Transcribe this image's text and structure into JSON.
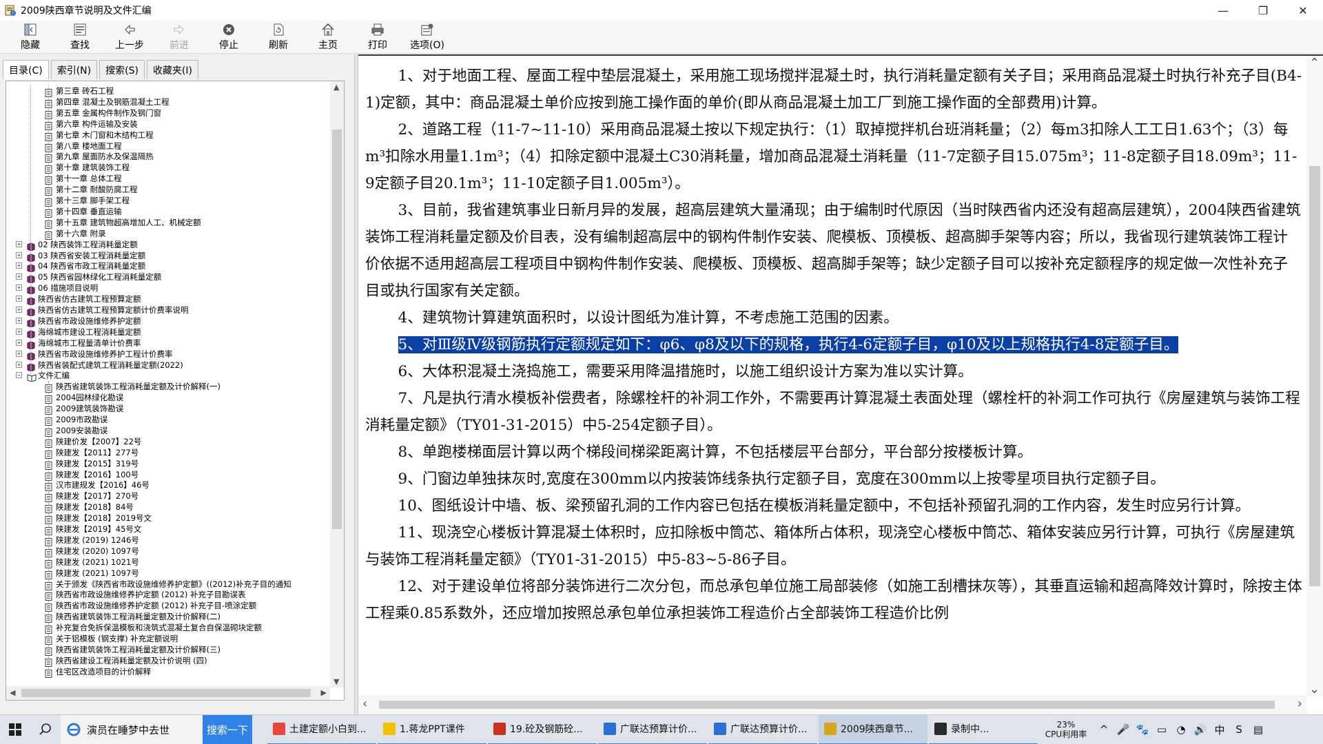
{
  "window": {
    "title": "2009陕西章节说明及文件汇编",
    "controls": [
      "—",
      "❐",
      "✕"
    ]
  },
  "toolbar": {
    "buttons": [
      {
        "label": "隐藏",
        "icon": "hide-icon",
        "disabled": false
      },
      {
        "label": "查找",
        "icon": "find-icon",
        "disabled": false
      },
      {
        "label": "上一步",
        "icon": "back-arrow-icon",
        "disabled": false
      },
      {
        "label": "前进",
        "icon": "forward-arrow-icon",
        "disabled": true
      },
      {
        "label": "停止",
        "icon": "stop-icon",
        "disabled": false
      },
      {
        "label": "刷新",
        "icon": "refresh-icon",
        "disabled": false
      },
      {
        "label": "主页",
        "icon": "home-icon",
        "disabled": false
      },
      {
        "label": "打印",
        "icon": "print-icon",
        "disabled": false
      },
      {
        "label": "选项(O)",
        "icon": "options-icon",
        "disabled": false
      }
    ]
  },
  "tabs": [
    {
      "label": "目录(C)",
      "active": true
    },
    {
      "label": "索引(N)",
      "active": false
    },
    {
      "label": "搜索(S)",
      "active": false
    },
    {
      "label": "收藏夹(I)",
      "active": false
    }
  ],
  "tree": [
    {
      "label": "第三章 砖石工程",
      "level": 3,
      "type": "page"
    },
    {
      "label": "第四章 混凝土及钢筋混凝土工程",
      "level": 3,
      "type": "page"
    },
    {
      "label": "第五章 金属构件制作及钢门窗",
      "level": 3,
      "type": "page"
    },
    {
      "label": "第六章 构件运输及安装",
      "level": 3,
      "type": "page"
    },
    {
      "label": "第七章 木门窗和木结构工程",
      "level": 3,
      "type": "page"
    },
    {
      "label": "第八章 楼地面工程",
      "level": 3,
      "type": "page"
    },
    {
      "label": "第九章 屋面防水及保温隔热",
      "level": 3,
      "type": "page"
    },
    {
      "label": "第十章 建筑装饰工程",
      "level": 3,
      "type": "page"
    },
    {
      "label": "第十一章 总体工程",
      "level": 3,
      "type": "page"
    },
    {
      "label": "第十二章 耐酸防腐工程",
      "level": 3,
      "type": "page"
    },
    {
      "label": "第十三章 脚手架工程",
      "level": 3,
      "type": "page"
    },
    {
      "label": "第十四章 垂直运输",
      "level": 3,
      "type": "page"
    },
    {
      "label": "第十五章 建筑物超高增加人工、机械定额",
      "level": 3,
      "type": "page"
    },
    {
      "label": "第十六章 附录",
      "level": 3,
      "type": "page"
    },
    {
      "label": "02 陕西装饰工程消耗量定额",
      "level": 2,
      "type": "book",
      "exp": "+"
    },
    {
      "label": "03 陕西省安装工程消耗量定额",
      "level": 2,
      "type": "book",
      "exp": "+"
    },
    {
      "label": "04 陕西省市政工程消耗量定额",
      "level": 2,
      "type": "book",
      "exp": "+"
    },
    {
      "label": "05 陕西省园林绿化工程消耗量定额",
      "level": 2,
      "type": "book",
      "exp": "+"
    },
    {
      "label": "06 措施项目说明",
      "level": 2,
      "type": "book",
      "exp": "+"
    },
    {
      "label": "陕西省仿古建筑工程预算定额",
      "level": 2,
      "type": "book",
      "exp": "+"
    },
    {
      "label": "陕西省仿古建筑工程预算定额计价费率说明",
      "level": 2,
      "type": "book",
      "exp": "+"
    },
    {
      "label": "陕西省市政设施维修养护定额",
      "level": 2,
      "type": "book",
      "exp": "+"
    },
    {
      "label": "海绵城市建设工程消耗量定额",
      "level": 2,
      "type": "book",
      "exp": "+"
    },
    {
      "label": "海绵城市工程量清单计价费率",
      "level": 2,
      "type": "book",
      "exp": "+"
    },
    {
      "label": "陕西省市政设施维修养护工程计价费率",
      "level": 2,
      "type": "book",
      "exp": "+"
    },
    {
      "label": "陕西省装配式建筑工程消耗量定额(2022)",
      "level": 2,
      "type": "book",
      "exp": "+"
    },
    {
      "label": "文件汇编",
      "level": 2,
      "type": "openbook",
      "exp": "−"
    },
    {
      "label": "陕西省建筑装饰工程消耗量定额及计价解释(一)",
      "level": 3,
      "type": "page"
    },
    {
      "label": "2004园林绿化勘误",
      "level": 3,
      "type": "page"
    },
    {
      "label": "2009建筑装饰勘误",
      "level": 3,
      "type": "page"
    },
    {
      "label": "2009市政勘误",
      "level": 3,
      "type": "page"
    },
    {
      "label": "2009安装勘误",
      "level": 3,
      "type": "page"
    },
    {
      "label": "陕建价发【2007】22号",
      "level": 3,
      "type": "page"
    },
    {
      "label": "陕建发【2011】277号",
      "level": 3,
      "type": "page"
    },
    {
      "label": "陕建发【2015】319号",
      "level": 3,
      "type": "page"
    },
    {
      "label": "陕建发【2016】100号",
      "level": 3,
      "type": "page"
    },
    {
      "label": "汉市建规发【2016】46号",
      "level": 3,
      "type": "page"
    },
    {
      "label": "陕建发【2017】270号",
      "level": 3,
      "type": "page"
    },
    {
      "label": "陕建发【2018】84号",
      "level": 3,
      "type": "page"
    },
    {
      "label": "陕建发【2018】2019号文",
      "level": 3,
      "type": "page"
    },
    {
      "label": "陕建发【2019】45号文",
      "level": 3,
      "type": "page"
    },
    {
      "label": "陕建发 (2019) 1246号",
      "level": 3,
      "type": "page"
    },
    {
      "label": "陕建发 (2020) 1097号",
      "level": 3,
      "type": "page"
    },
    {
      "label": "陕建发 (2021) 1021号",
      "level": 3,
      "type": "page"
    },
    {
      "label": "陕建发 (2021) 1097号",
      "level": 3,
      "type": "page"
    },
    {
      "label": "关于颁发《陕西省市政设施维修养护定额》((2012)补充子目的通知",
      "level": 3,
      "type": "page"
    },
    {
      "label": "陕西省市政设施维修养护定额 (2012) 补充子目勘误表",
      "level": 3,
      "type": "page"
    },
    {
      "label": "陕西省市政设施维修养护定额 (2012) 补充子目-喷涂定额",
      "level": 3,
      "type": "page"
    },
    {
      "label": "陕西省建筑装饰工程消耗量定额及计价解释(二)",
      "level": 3,
      "type": "page"
    },
    {
      "label": "补充复合免拆保温模板和浇筑式混凝土复合自保温砌块定额",
      "level": 3,
      "type": "page"
    },
    {
      "label": "关于铝模板 (钢支撑) 补充定额说明",
      "level": 3,
      "type": "page"
    },
    {
      "label": "陕西省建筑装饰工程消耗量定额及计价解释(三)",
      "level": 3,
      "type": "page"
    },
    {
      "label": "陕西省建设工程消耗量定额及计价说明 (四)",
      "level": 3,
      "type": "page"
    },
    {
      "label": "住宅区改造项目的计价解释",
      "level": 3,
      "type": "page"
    }
  ],
  "document": {
    "paragraphs": [
      {
        "text": "1、对于地面工程、屋面工程中垫层混凝土，采用施工现场搅拌混凝土时，执行消耗量定额有关子目；采用商品混凝土时执行补充子目(B4-1)定额，其中：商品混凝土单价应按到施工操作面的单价(即从商品混凝土加工厂到施工操作面的全部费用)计算。",
        "highlight": false
      },
      {
        "text": "2、道路工程（11-7~11-10）采用商品混凝土按以下规定执行：（1）取掉搅拌机台班消耗量；（2）每m3扣除人工工日1.63个；（3）每m³扣除水用量1.1m³；（4）扣除定额中混凝土C30消耗量，增加商品混凝土消耗量（11-7定额子目15.075m³；11-8定额子目18.09m³；11-9定额子目20.1m³；11-10定额子目1.005m³）。",
        "highlight": false
      },
      {
        "text": "3、目前，我省建筑事业日新月异的发展，超高层建筑大量涌现；由于编制时代原因（当时陕西省内还没有超高层建筑），2004陕西省建筑装饰工程消耗量定额及价目表，没有编制超高层中的钢构件制作安装、爬模板、顶模板、超高脚手架等内容；所以，我省现行建筑装饰工程计价依据不适用超高层工程项目中钢构件制作安装、爬模板、顶模板、超高脚手架等；缺少定额子目可以按补充定额程序的规定做一次性补充子目或执行国家有关定额。",
        "highlight": false
      },
      {
        "text": "4、建筑物计算建筑面积时，以设计图纸为准计算，不考虑施工范围的因素。",
        "highlight": false
      },
      {
        "text": "5、对Ⅲ级Ⅳ级钢筋执行定额规定如下：φ6、φ8及以下的规格，执行4-6定额子目，φ10及以上规格执行4-8定额子目。",
        "highlight": true
      },
      {
        "text": "6、大体积混凝土浇捣施工，需要采用降温措施时，以施工组织设计方案为准以实计算。",
        "highlight": false
      },
      {
        "text": "7、凡是执行清水模板补偿费者，除螺栓杆的补洞工作外，不需要再计算混凝土表面处理（螺栓杆的补洞工作可执行《房屋建筑与装饰工程消耗量定额》（TY01-31-2015）中5-254定额子目）。",
        "highlight": false
      },
      {
        "text": "8、单跑楼梯面层计算以两个梯段间梯梁距离计算，不包括楼层平台部分，平台部分按楼板计算。",
        "highlight": false
      },
      {
        "text": "9、门窗边单独抹灰时,宽度在300mm以内按装饰线条执行定额子目，宽度在300mm以上按零星项目执行定额子目。",
        "highlight": false
      },
      {
        "text": "10、图纸设计中墙、板、梁预留孔洞的工作内容已包括在模板消耗量定额中，不包括补预留孔洞的工作内容，发生时应另行计算。",
        "highlight": false
      },
      {
        "text": "11、现浇空心楼板计算混凝土体积时，应扣除板中筒芯、箱体所占体积，现浇空心楼板中筒芯、箱体安装应另行计算，可执行《房屋建筑与装饰工程消耗量定额》（TY01-31-2015）中5-83~5-86子目。",
        "highlight": false
      },
      {
        "text": "12、对于建设单位将部分装饰进行二次分包，而总承包单位施工局部装修（如施工刮槽抹灰等），其垂直运输和超高降效计算时，除按主体工程乘0.85系数外，还应增加按照总承包单位承担装饰工程造价占全部装饰工程造价比例",
        "highlight": false
      }
    ]
  },
  "taskbar": {
    "search_text": "演员在睡梦中去世",
    "search_button": "搜索一下",
    "tasks": [
      {
        "label": "土建定额小白到...",
        "icon_color": "#e8453c",
        "active": false
      },
      {
        "label": "1.蒋龙PPT课件",
        "icon_color": "#f2c200",
        "active": false
      },
      {
        "label": "19.砼及钢筋砼...",
        "icon_color": "#c8331f",
        "active": false
      },
      {
        "label": "广联达预算计价...",
        "icon_color": "#2b6fd6",
        "active": false
      },
      {
        "label": "广联达预算计价...",
        "icon_color": "#2b6fd6",
        "active": false
      },
      {
        "label": "2009陕西章节...",
        "icon_color": "#d9a520",
        "active": true
      },
      {
        "label": "录制中...",
        "icon_color": "#2a2a2a",
        "active": false
      }
    ],
    "cpu_percent": "23%",
    "cpu_label": "CPU利用率",
    "tray": [
      "^",
      "🎤",
      "🐾",
      "▭",
      "◔",
      "🔊",
      "中",
      "S",
      "▤"
    ]
  }
}
